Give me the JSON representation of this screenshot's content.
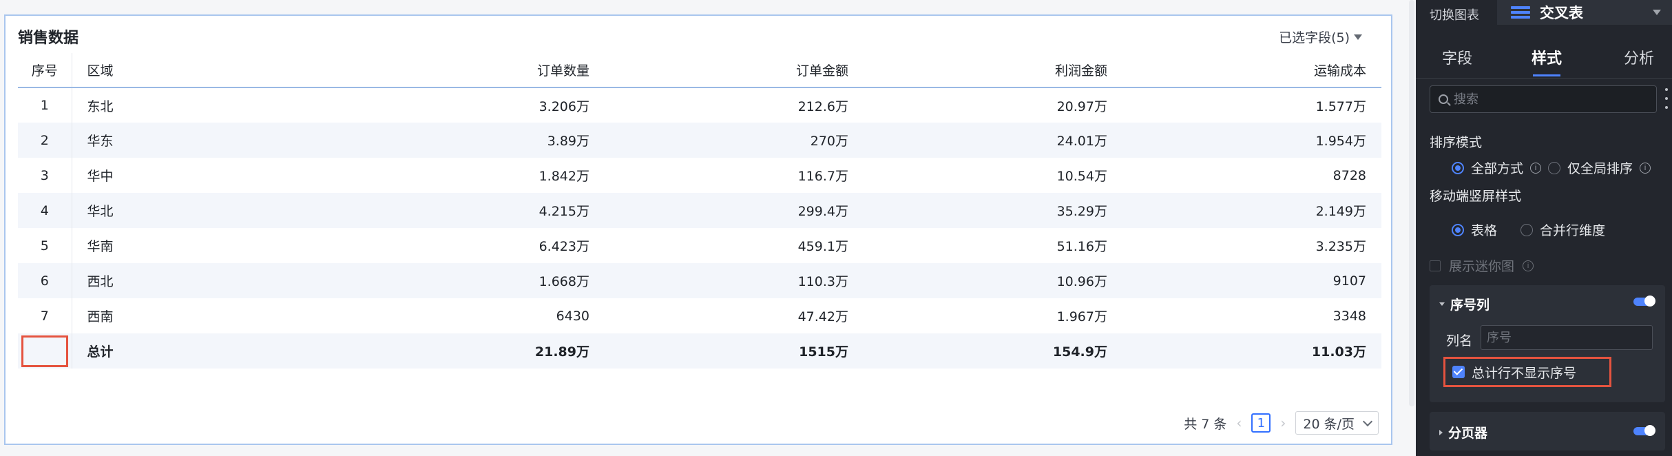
{
  "table": {
    "title": "销售数据",
    "fields_picker": "已选字段(5)",
    "headers": [
      "序号",
      "区域",
      "订单数量",
      "订单金额",
      "利润金额",
      "运输成本"
    ],
    "rows": [
      {
        "idx": "1",
        "region": "东北",
        "qty": "3.206万",
        "amount": "212.6万",
        "profit": "20.97万",
        "shipping": "1.577万"
      },
      {
        "idx": "2",
        "region": "华东",
        "qty": "3.89万",
        "amount": "270万",
        "profit": "24.01万",
        "shipping": "1.954万"
      },
      {
        "idx": "3",
        "region": "华中",
        "qty": "1.842万",
        "amount": "116.7万",
        "profit": "10.54万",
        "shipping": "8728"
      },
      {
        "idx": "4",
        "region": "华北",
        "qty": "4.215万",
        "amount": "299.4万",
        "profit": "35.29万",
        "shipping": "2.149万"
      },
      {
        "idx": "5",
        "region": "华南",
        "qty": "6.423万",
        "amount": "459.1万",
        "profit": "51.16万",
        "shipping": "3.235万"
      },
      {
        "idx": "6",
        "region": "西北",
        "qty": "1.668万",
        "amount": "110.3万",
        "profit": "10.96万",
        "shipping": "9107"
      },
      {
        "idx": "7",
        "region": "西南",
        "qty": "6430",
        "amount": "47.42万",
        "profit": "1.967万",
        "shipping": "3348"
      }
    ],
    "total": {
      "region": "总计",
      "qty": "21.89万",
      "amount": "1515万",
      "profit": "154.9万",
      "shipping": "11.03万"
    }
  },
  "pagination": {
    "total_text": "共 7 条",
    "prev": "‹",
    "current_page": "1",
    "next": "›",
    "page_size": "20 条/页"
  },
  "panel": {
    "switch_label": "切换图表",
    "chart_type": "交叉表",
    "tabs": [
      "字段",
      "样式",
      "分析"
    ],
    "active_tab": "样式",
    "search_placeholder": "搜索",
    "sort_mode": {
      "label": "排序模式",
      "options": [
        "全部方式",
        "仅全局排序"
      ],
      "selected": "全部方式"
    },
    "mobile_style": {
      "label": "移动端竖屏样式",
      "options": [
        "表格",
        "合并行维度"
      ],
      "selected": "表格"
    },
    "show_mini_chart": "展示迷你图",
    "index_column": {
      "title": "序号列",
      "enabled": true,
      "colname_label": "列名",
      "colname_placeholder": "序号",
      "hide_in_total_label": "总计行不显示序号",
      "hide_in_total_checked": true
    },
    "paginator": {
      "title": "分页器",
      "enabled": true
    }
  },
  "colors": {
    "accent": "#4e83fd",
    "highlight": "#e5533f",
    "panel_bg": "#23262d"
  }
}
